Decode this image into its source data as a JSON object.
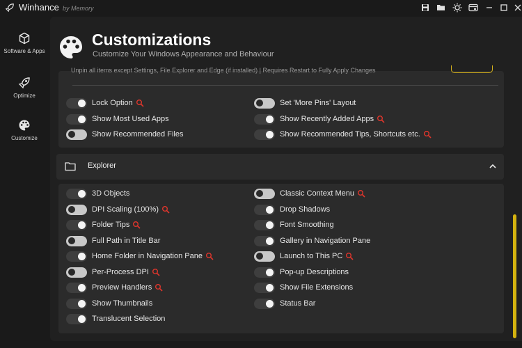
{
  "app": {
    "title": "Winhance",
    "subtitle": "by Memory"
  },
  "sidebar": {
    "items": [
      {
        "label": "Software & Apps",
        "icon": "package-icon"
      },
      {
        "label": "Optimize",
        "icon": "rocket-icon"
      },
      {
        "label": "Customize",
        "icon": "palette-icon"
      }
    ]
  },
  "header": {
    "title": "Customizations",
    "subtitle": "Customize Your Windows Appearance and Behaviour"
  },
  "top_card": {
    "cut_text": "Unpin all items except Settings, File Explorer and Edge (if installed) | Requires Restart to Fully Apply Changes",
    "options": [
      {
        "label": "Lock Option",
        "on": false,
        "restart": true
      },
      {
        "label": "Set 'More Pins' Layout",
        "on": true,
        "restart": false
      },
      {
        "label": "Show Most Used Apps",
        "on": false,
        "restart": false
      },
      {
        "label": "Show Recently Added Apps",
        "on": false,
        "restart": true
      },
      {
        "label": "Show Recommended Files",
        "on": true,
        "restart": false
      },
      {
        "label": "Show Recommended Tips, Shortcuts etc.",
        "on": false,
        "restart": true
      }
    ]
  },
  "explorer": {
    "title": "Explorer",
    "options_left": [
      {
        "label": "3D Objects",
        "on": false,
        "restart": false
      },
      {
        "label": "DPI Scaling (100%)",
        "on": true,
        "restart": true
      },
      {
        "label": "Folder Tips",
        "on": false,
        "restart": true
      },
      {
        "label": "Full Path in Title Bar",
        "on": true,
        "restart": false
      },
      {
        "label": "Home Folder in Navigation Pane",
        "on": false,
        "restart": true
      },
      {
        "label": "Per-Process DPI",
        "on": true,
        "restart": true
      },
      {
        "label": "Preview Handlers",
        "on": false,
        "restart": true
      },
      {
        "label": "Show Thumbnails",
        "on": false,
        "restart": false
      },
      {
        "label": "Translucent Selection",
        "on": false,
        "restart": false
      }
    ],
    "options_right": [
      {
        "label": "Classic Context Menu",
        "on": true,
        "restart": true
      },
      {
        "label": "Drop Shadows",
        "on": false,
        "restart": false
      },
      {
        "label": "Font Smoothing",
        "on": false,
        "restart": false
      },
      {
        "label": "Gallery in Navigation Pane",
        "on": false,
        "restart": false
      },
      {
        "label": "Launch to This PC",
        "on": true,
        "restart": true
      },
      {
        "label": "Pop-up Descriptions",
        "on": false,
        "restart": false
      },
      {
        "label": "Show File Extensions",
        "on": false,
        "restart": false
      },
      {
        "label": "Status Bar",
        "on": false,
        "restart": false
      }
    ]
  },
  "colors": {
    "accent": "#d4b20f",
    "restart_icon": "#e0362c"
  }
}
